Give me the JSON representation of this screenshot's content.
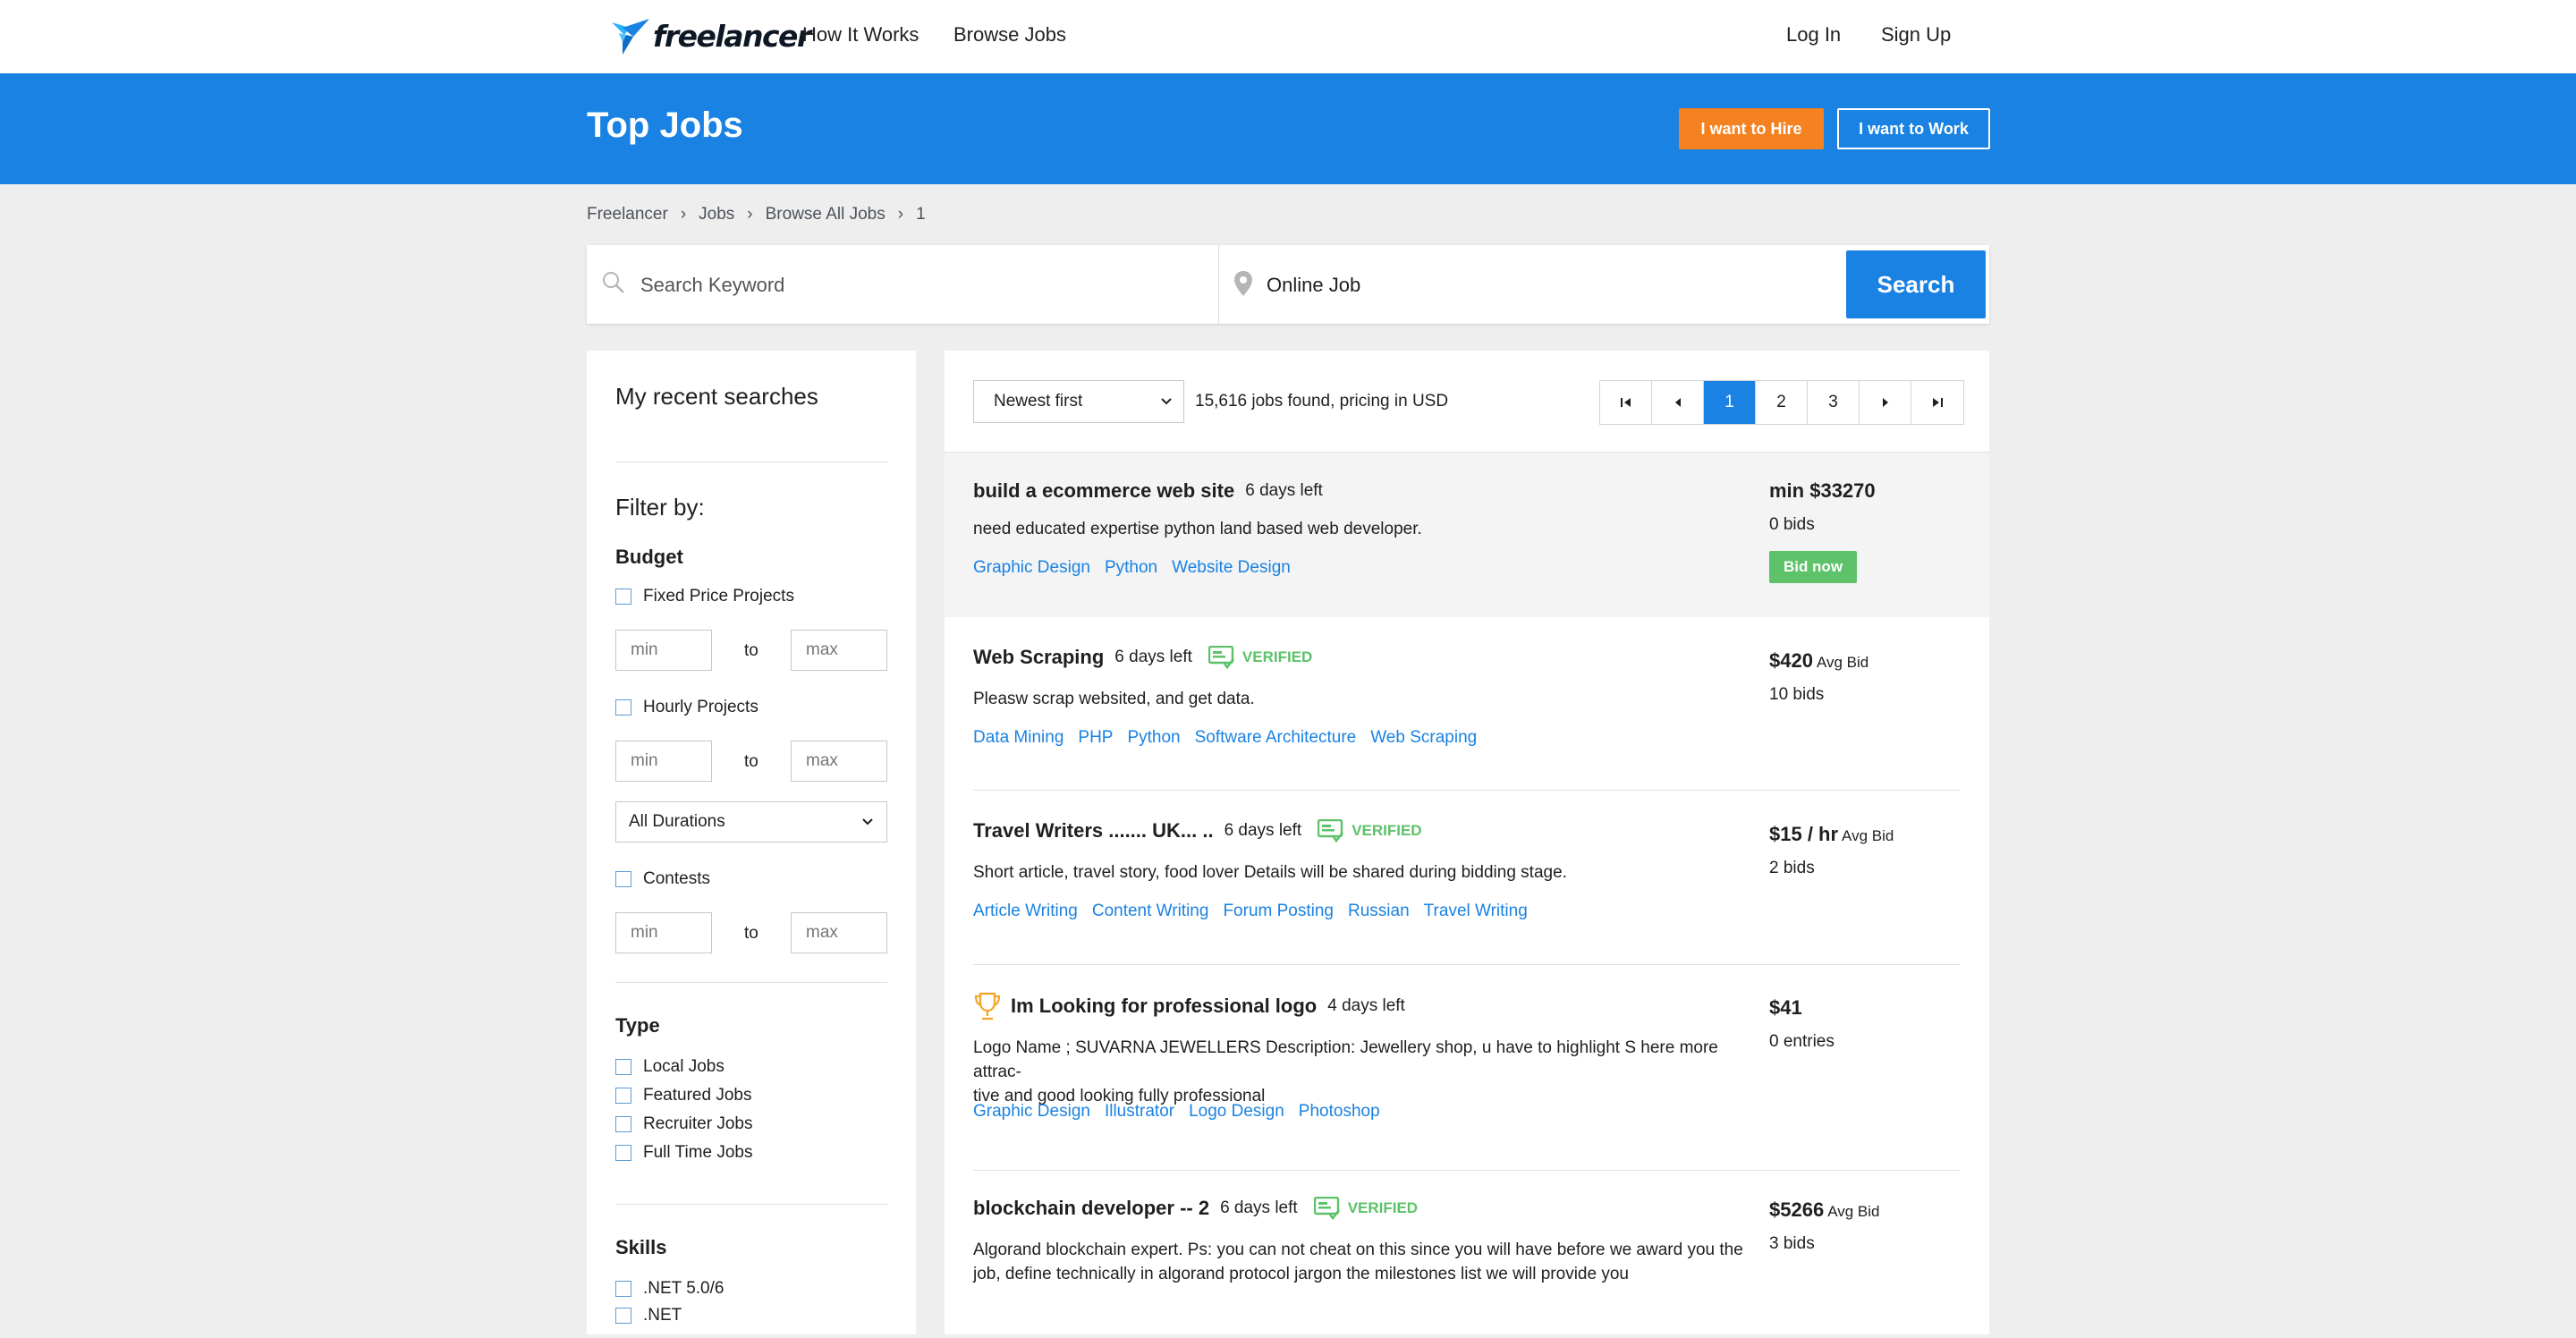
{
  "nav": {
    "logo_text": "freelancer",
    "how_it_works": "How It Works",
    "browse_jobs": "Browse Jobs",
    "log_in": "Log In",
    "sign_up": "Sign Up"
  },
  "banner": {
    "title": "Top Jobs",
    "hire_label": "I want to Hire",
    "work_label": "I want to Work"
  },
  "breadcrumb": [
    "Freelancer",
    "Jobs",
    "Browse All Jobs",
    "1"
  ],
  "search": {
    "keyword_placeholder": "Search Keyword",
    "location_value": "Online Job",
    "button_label": "Search"
  },
  "sidebar": {
    "recent_title": "My recent searches",
    "filter_title": "Filter by:",
    "budget_title": "Budget",
    "fixed_label": "Fixed Price Projects",
    "hourly_label": "Hourly Projects",
    "contests_label": "Contests",
    "min_placeholder": "min",
    "max_placeholder": "max",
    "to_label": "to",
    "duration_value": "All Durations",
    "type_title": "Type",
    "types": [
      "Local Jobs",
      "Featured Jobs",
      "Recruiter Jobs",
      "Full Time Jobs"
    ],
    "skills_title": "Skills",
    "skills": [
      ".NET 5.0/6",
      ".NET"
    ]
  },
  "results": {
    "sort_value": "Newest first",
    "count_text": "15,616 jobs found, pricing in USD",
    "pages": [
      "1",
      "2",
      "3"
    ],
    "verified_label": "VERIFIED",
    "bid_now": "Bid now",
    "avg_bid": "Avg Bid"
  },
  "jobs": [
    {
      "title": "build a ecommerce web site",
      "days": "6 days left",
      "desc": "need educated expertise python land based web developer.",
      "tags": [
        "Graphic Design",
        "Python",
        "Website Design"
      ],
      "price": "min $33270",
      "bids": "0 bids"
    },
    {
      "title": "Web Scraping",
      "days": "6 days left",
      "desc": "Pleasw scrap websited, and get data.",
      "tags": [
        "Data Mining",
        "PHP",
        "Python",
        "Software Architecture",
        "Web Scraping"
      ],
      "price": "$420",
      "bids": "10 bids"
    },
    {
      "title": "Travel Writers ....... UK... ..",
      "days": "6 days left",
      "desc": "Short article, travel story, food lover Details will be shared during bidding stage.",
      "tags": [
        "Article Writing",
        "Content Writing",
        "Forum Posting",
        "Russian",
        "Travel Writing"
      ],
      "price": "$15 / hr",
      "bids": "2 bids"
    },
    {
      "title": "Im Looking for professional logo",
      "days": "4 days left",
      "desc_line1": "Logo Name ; SUVARNA JEWELLERS Description: Jewellery shop, u have to highlight S here more attrac-",
      "desc_line2": "tive and good looking fully professional",
      "tags": [
        "Graphic Design",
        "Illustrator",
        "Logo Design",
        "Photoshop"
      ],
      "price": "$41",
      "bids": "0 entries"
    },
    {
      "title": "blockchain developer -- 2",
      "days": "6 days left",
      "desc_line1": "Algorand blockchain expert. Ps: you can not cheat on this since you will have before we award you the",
      "desc_line2": "job, define technically in algorand protocol jargon the milestones list we will provide you",
      "price": "$5266",
      "bids": "3 bids"
    }
  ],
  "colors": {
    "brand_blue": "#1a82e2",
    "hire_orange": "#f58220",
    "verified_green": "#5dc26a"
  }
}
